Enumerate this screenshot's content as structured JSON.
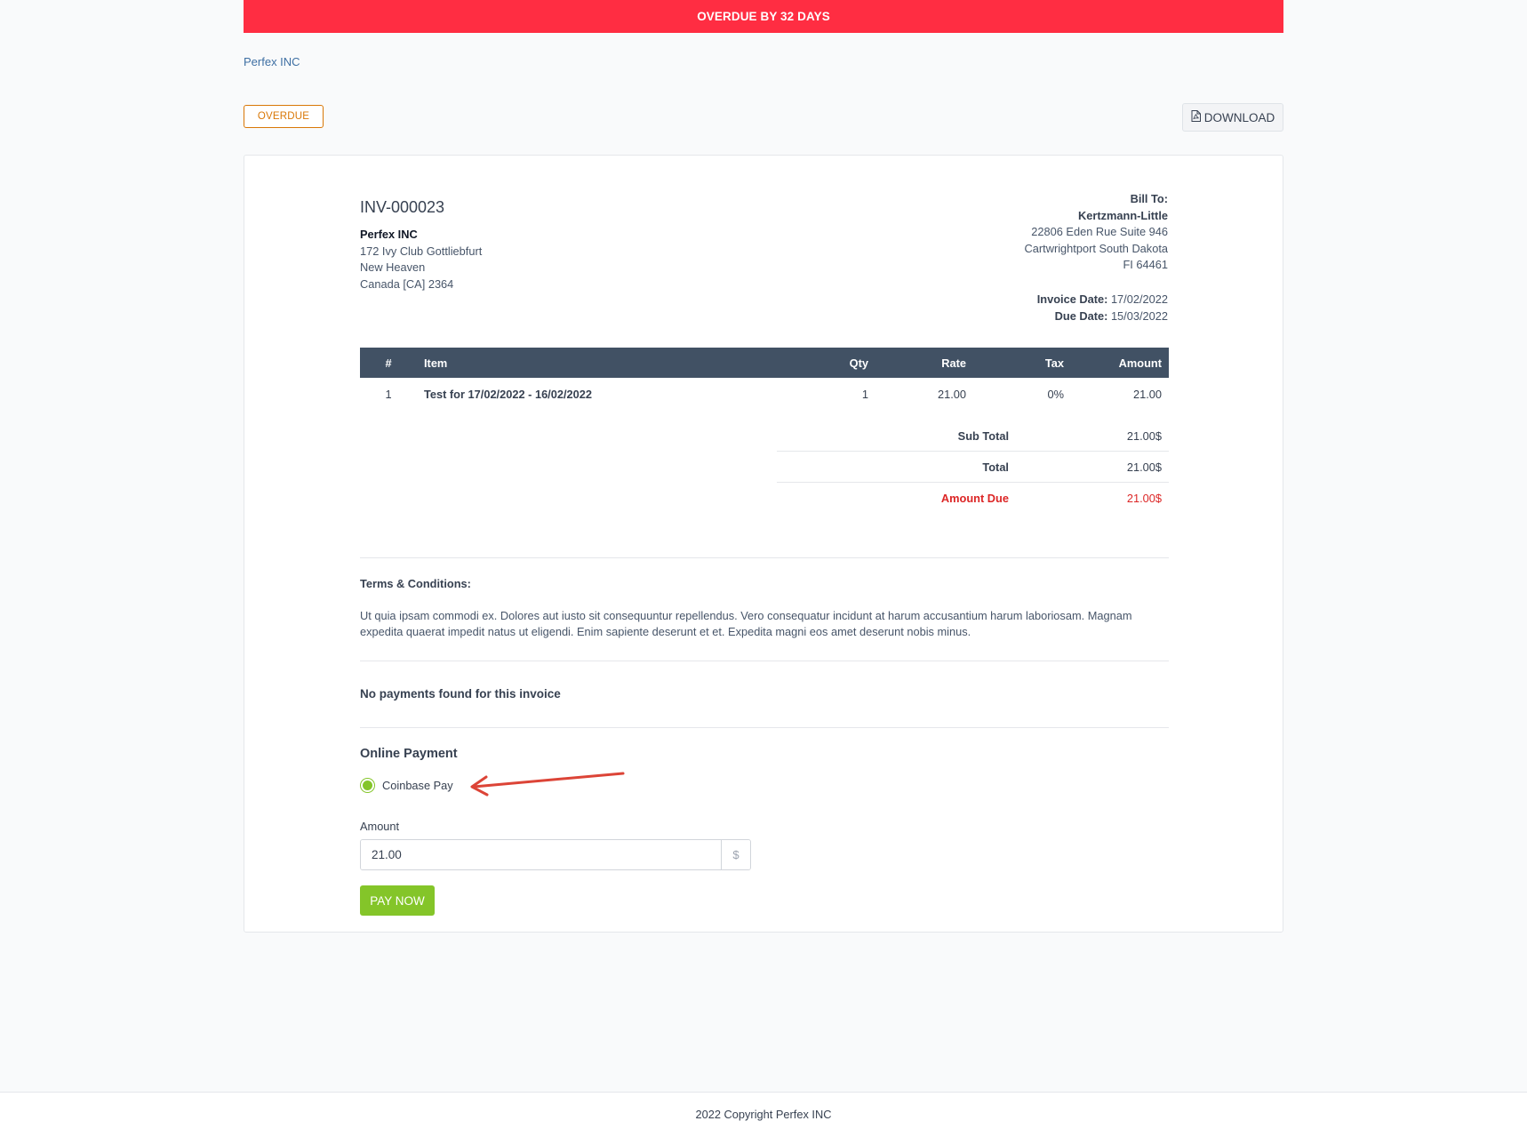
{
  "banner": {
    "text": "OVERDUE BY 32 DAYS",
    "color": "#ff2d42"
  },
  "company_link": "Perfex INC",
  "status": {
    "label": "OVERDUE",
    "color": "#d97706"
  },
  "download": {
    "label": "DOWNLOAD",
    "icon": "pdf-file-icon"
  },
  "invoice": {
    "number": "INV-000023",
    "from": {
      "name": "Perfex INC",
      "line1": "172 Ivy Club Gottliebfurt",
      "line2": "New Heaven",
      "line3": "Canada [CA] 2364"
    },
    "bill_to": {
      "heading": "Bill To:",
      "name": "Kertzmann-Little",
      "line1": "22806 Eden Rue Suite 946",
      "line2": "Cartwrightport South Dakota",
      "line3": "FI 64461"
    },
    "invoice_date_label": "Invoice Date:",
    "invoice_date": "17/02/2022",
    "due_date_label": "Due Date:",
    "due_date": "15/03/2022"
  },
  "table": {
    "headers": {
      "num": "#",
      "item": "Item",
      "qty": "Qty",
      "rate": "Rate",
      "tax": "Tax",
      "amount": "Amount"
    },
    "rows": [
      {
        "num": "1",
        "item": "Test for 17/02/2022 - 16/02/2022",
        "qty": "1",
        "rate": "21.00",
        "tax": "0%",
        "amount": "21.00"
      }
    ],
    "header_color": "#415164"
  },
  "totals": {
    "subtotal_label": "Sub Total",
    "subtotal": "21.00$",
    "total_label": "Total",
    "total": "21.00$",
    "due_label": "Amount Due",
    "due": "21.00$"
  },
  "terms": {
    "title": "Terms & Conditions:",
    "text": "Ut quia ipsam commodi ex. Dolores aut iusto sit consequuntur repellendus. Vero consequatur incidunt at harum accusantium harum laboriosam. Magnam expedita quaerat impedit natus ut eligendi. Enim sapiente deserunt et et. Expedita magni eos amet deserunt nobis minus."
  },
  "payments_message": "No payments found for this invoice",
  "online_payment": {
    "title": "Online Payment",
    "method": "Coinbase Pay",
    "amount_label": "Amount",
    "amount_value": "21.00",
    "currency_addon": "$",
    "pay_button": "PAY NOW",
    "accent": "#84c529"
  },
  "footer": "2022 Copyright Perfex INC"
}
